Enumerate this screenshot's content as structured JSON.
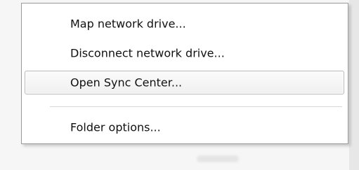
{
  "context_menu": {
    "items": [
      {
        "label": "Map network drive...",
        "hover": false
      },
      {
        "label": "Disconnect network drive...",
        "hover": false
      },
      {
        "label": "Open Sync Center...",
        "hover": true
      },
      {
        "label": "Folder options...",
        "hover": false
      }
    ]
  }
}
